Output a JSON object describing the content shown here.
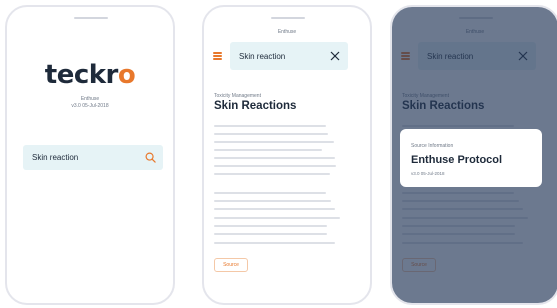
{
  "app": {
    "logo_text_main": "teckr",
    "logo_text_accent": "o",
    "name": "Enthuse",
    "version": "v3.0 05-Jul-2018"
  },
  "search": {
    "value": "Skin reaction"
  },
  "detail": {
    "header_title": "Enthuse",
    "section_label": "Toxicity Management",
    "page_title": "Skin Reactions",
    "source_button": "Source"
  },
  "modal": {
    "label": "Source Information",
    "title": "Enthuse Protocol",
    "version": "v3.0 05-Jul-2018"
  },
  "colors": {
    "accent": "#e8782c",
    "search_bg": "#e6f3f6",
    "text_dark": "#1e2a3a",
    "overlay": "#263a5a"
  },
  "icons": [
    "search-icon",
    "menu-icon",
    "close-icon"
  ]
}
